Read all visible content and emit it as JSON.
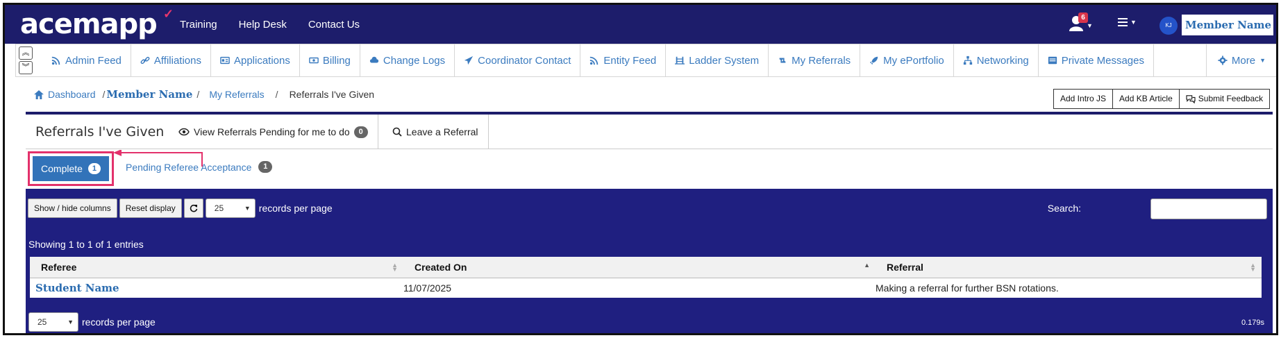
{
  "app": {
    "logo": "acemapp",
    "top_links": [
      "Training",
      "Help Desk",
      "Contact Us"
    ],
    "notification_count": "6",
    "avatar_initials": "KJ",
    "member_name": "Member Name",
    "brand_color": "#1d1d6b",
    "accent_color": "#e3316b"
  },
  "subnav": {
    "items": [
      {
        "label": "Admin Feed",
        "icon": "rss-icon"
      },
      {
        "label": "Affiliations",
        "icon": "link-icon"
      },
      {
        "label": "Applications",
        "icon": "id-card-icon"
      },
      {
        "label": "Billing",
        "icon": "money-icon"
      },
      {
        "label": "Change Logs",
        "icon": "cloud-upload-icon"
      },
      {
        "label": "Coordinator Contact",
        "icon": "paper-plane-icon"
      },
      {
        "label": "Entity Feed",
        "icon": "rss-icon"
      },
      {
        "label": "Ladder System",
        "icon": "ladder-icon"
      },
      {
        "label": "My Referrals",
        "icon": "retweet-icon"
      },
      {
        "label": "My ePortfolio",
        "icon": "rocket-icon"
      },
      {
        "label": "Networking",
        "icon": "sitemap-icon"
      },
      {
        "label": "Private Messages",
        "icon": "envelope-icon"
      }
    ],
    "more_label": "More"
  },
  "breadcrumb": {
    "dashboard": "Dashboard",
    "sep1": "/",
    "member": "Member Name",
    "sep2": "/",
    "my_referrals": "My Referrals",
    "sep3": "/",
    "current": "Referrals I've Given"
  },
  "toolbar": {
    "add_intro": "Add Intro JS",
    "add_kb": "Add KB Article",
    "submit_feedback": "Submit Feedback"
  },
  "panel": {
    "title": "Referrals I've Given",
    "pending_label": "View Referrals Pending for me to do",
    "pending_count": "0",
    "leave_label": "Leave a Referral"
  },
  "tabs": {
    "complete_label": "Complete",
    "complete_count": "1",
    "pending_label": "Pending Referee Acceptance",
    "pending_count": "1"
  },
  "table_controls": {
    "show_hide": "Show / hide columns",
    "reset": "Reset display",
    "page_size": "25",
    "records_per_page": "records per page",
    "search_label": "Search:",
    "search_value": "",
    "showing": "Showing 1 to 1 of 1 entries",
    "timing": "0.179s"
  },
  "table": {
    "columns": [
      "Referee",
      "Created On",
      "Referral"
    ],
    "rows": [
      {
        "referee": "Student Name",
        "created_on": "11/07/2025",
        "referral": "Making a referral for further BSN rotations."
      }
    ]
  }
}
